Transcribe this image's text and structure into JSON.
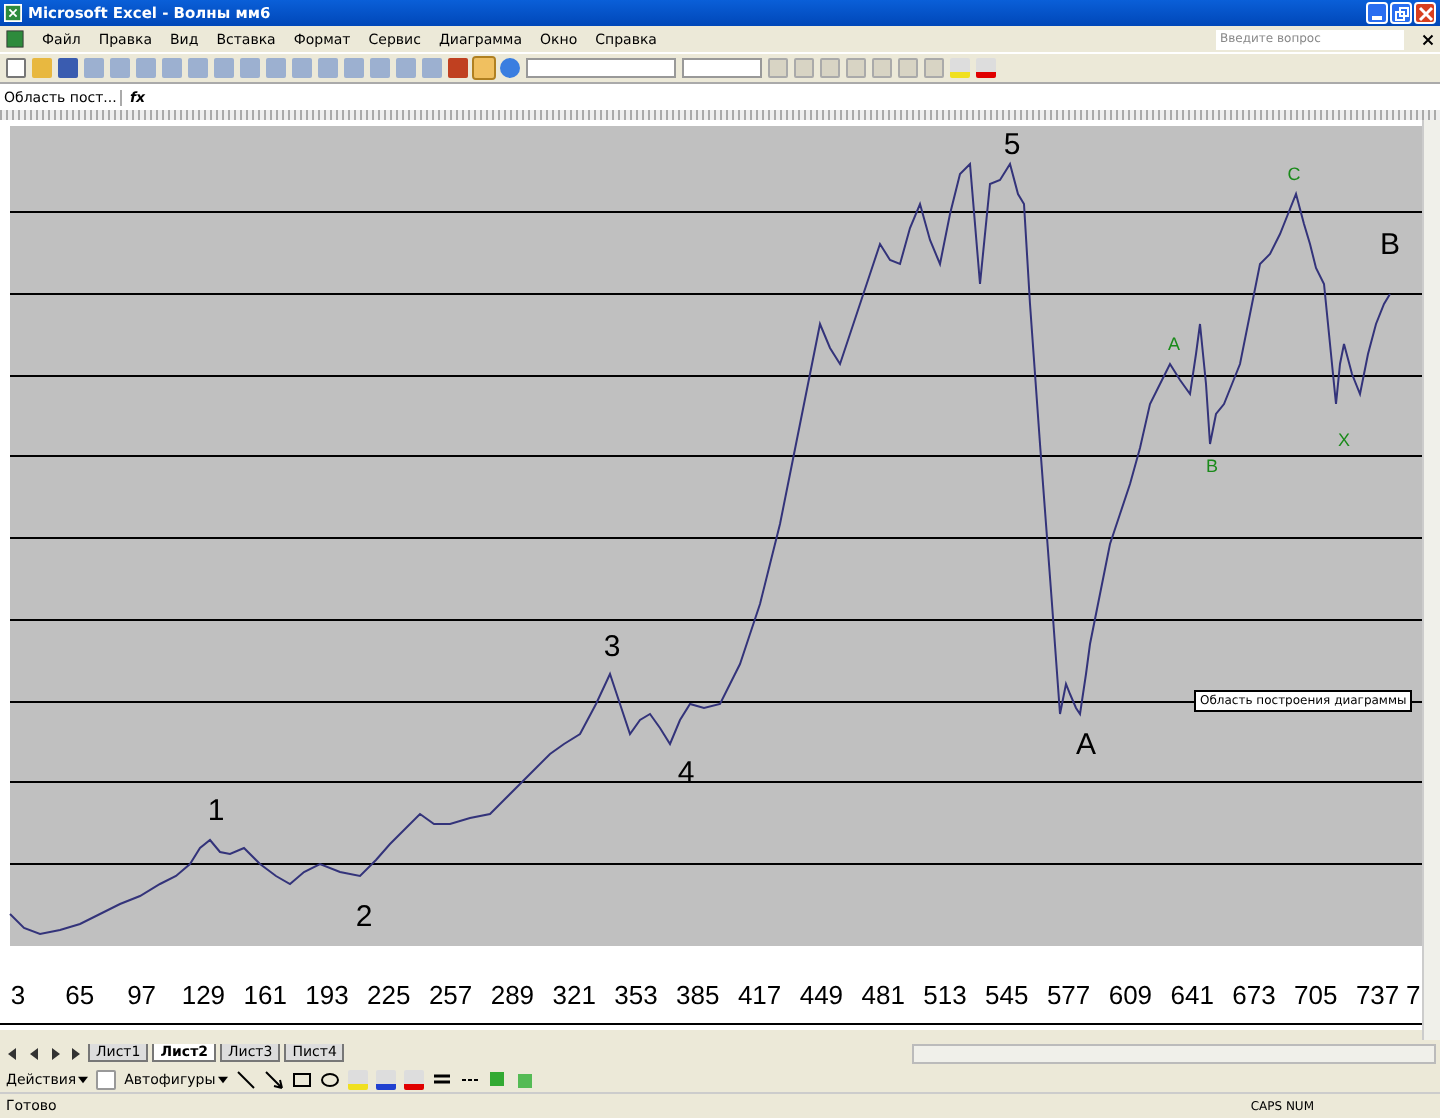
{
  "window": {
    "title": "Microsoft Excel - Волны мм6"
  },
  "menu": [
    "Файл",
    "Правка",
    "Вид",
    "Вставка",
    "Формат",
    "Сервис",
    "Диаграмма",
    "Окно",
    "Справка"
  ],
  "help_search": {
    "placeholder": "Введите вопрос"
  },
  "name_box": "Область пост...",
  "formula_label": "fx",
  "chart": {
    "x_labels": [
      "3",
      "65",
      "97",
      "129",
      "161",
      "193",
      "225",
      "257",
      "289",
      "321",
      "353",
      "385",
      "417",
      "449",
      "481",
      "513",
      "545",
      "577",
      "609",
      "641",
      "673",
      "705",
      "737",
      "7"
    ],
    "wave_labels": [
      {
        "text": "1",
        "kind": "major"
      },
      {
        "text": "2",
        "kind": "major"
      },
      {
        "text": "3",
        "kind": "major"
      },
      {
        "text": "4",
        "kind": "major"
      },
      {
        "text": "5",
        "kind": "major"
      },
      {
        "text": "A",
        "kind": "major"
      },
      {
        "text": "B",
        "kind": "major"
      },
      {
        "text": "A",
        "kind": "minor"
      },
      {
        "text": "B",
        "kind": "minor"
      },
      {
        "text": "C",
        "kind": "minor"
      },
      {
        "text": "X",
        "kind": "minor"
      }
    ],
    "tooltip": "Область построения диаграммы"
  },
  "sheet_tabs": [
    {
      "label": "Лист1",
      "selected": false
    },
    {
      "label": "Лист2",
      "selected": true
    },
    {
      "label": "Лист3",
      "selected": false
    },
    {
      "label": "Пист4",
      "selected": false
    }
  ],
  "drawing_toolbar": {
    "actions": "Действия",
    "autoshapes": "Автофигуры"
  },
  "status_bar": {
    "left": "Готово",
    "right": "CAPS NUM"
  }
}
